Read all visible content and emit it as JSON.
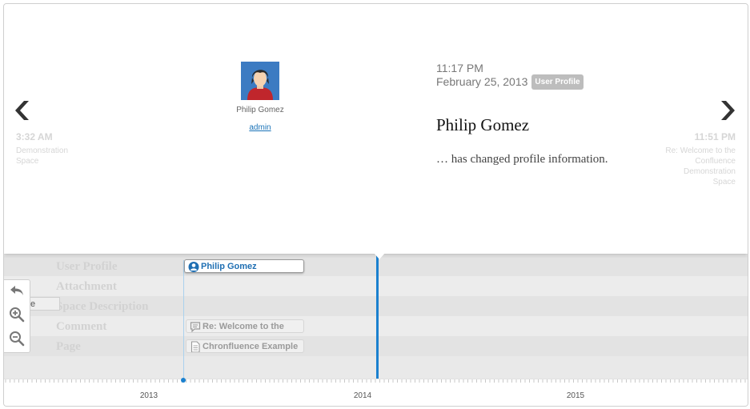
{
  "slider": {
    "prev": {
      "time": "3:32 AM",
      "title": "Demonstration Space"
    },
    "next": {
      "time": "11:51 PM",
      "title": "Re: Welcome to the Confluence Demonstration Space"
    },
    "media": {
      "caption": "Philip Gomez",
      "link": "admin",
      "icon": "user-avatar-icon"
    },
    "event": {
      "time": "11:17 PM",
      "date": "February 25, 2013",
      "badge": "User Profile",
      "headline": "Philip Gomez",
      "text": "… has changed profile information."
    }
  },
  "timeline": {
    "bands": [
      "User Profile",
      "Attachment",
      "Space Description",
      "Comment",
      "Page"
    ],
    "markers": {
      "active": "Philip Gomez",
      "comment": "Re: Welcome to the",
      "page": "Chronfluence Example"
    },
    "ghost_label": "e",
    "years": [
      "2013",
      "2014",
      "2015"
    ],
    "icons": [
      "back-icon",
      "zoom-in-icon",
      "zoom-out-icon"
    ]
  },
  "colors": {
    "accent": "#1a80cf",
    "band_dark": "#e2e2e2",
    "band_light": "#ececec",
    "badge": "#bdbdbd"
  }
}
